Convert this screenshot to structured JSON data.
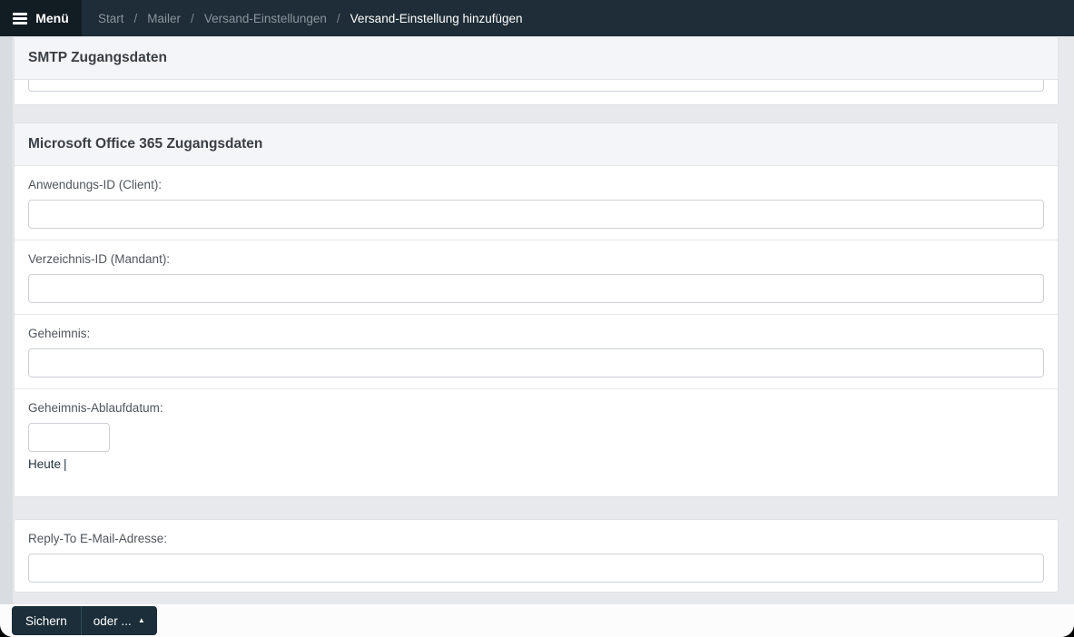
{
  "navbar": {
    "menu_label": "Menü",
    "separator": "/",
    "breadcrumbs": [
      {
        "label": "Start"
      },
      {
        "label": "Mailer"
      },
      {
        "label": "Versand-Einstellungen"
      },
      {
        "label": "Versand-Einstellung hinzufügen"
      }
    ]
  },
  "panels": {
    "smtp": {
      "title": "SMTP Zugangsdaten",
      "partial_field": {
        "value": ""
      }
    },
    "office365": {
      "title": "Microsoft Office 365 Zugangsdaten",
      "fields": [
        {
          "label": "Anwendungs-ID (Client):",
          "value": ""
        },
        {
          "label": "Verzeichnis-ID (Mandant):",
          "value": ""
        },
        {
          "label": "Geheimnis:",
          "value": ""
        },
        {
          "label": "Geheimnis-Ablaufdatum:",
          "value": ""
        }
      ],
      "date_shortcuts": {
        "today_label": "Heute",
        "separator": "|"
      }
    },
    "reply_to": {
      "fields": [
        {
          "label": "Reply-To E-Mail-Adresse:",
          "value": ""
        }
      ]
    }
  },
  "footer": {
    "save_label": "Sichern",
    "or_label": "oder ...",
    "caret": "▲"
  },
  "colors": {
    "navbar_bg": "#1e2d37",
    "menu_toggle_bg": "#121c23",
    "body_bg": "#e7e9ed",
    "panel_bg": "#ffffff",
    "panel_header_bg": "#f4f5f8",
    "button_bg": "#1b2e39",
    "breadcrumb_text": "#8b959d",
    "breadcrumb_current": "#ffffff",
    "link_text": "#22333e"
  }
}
